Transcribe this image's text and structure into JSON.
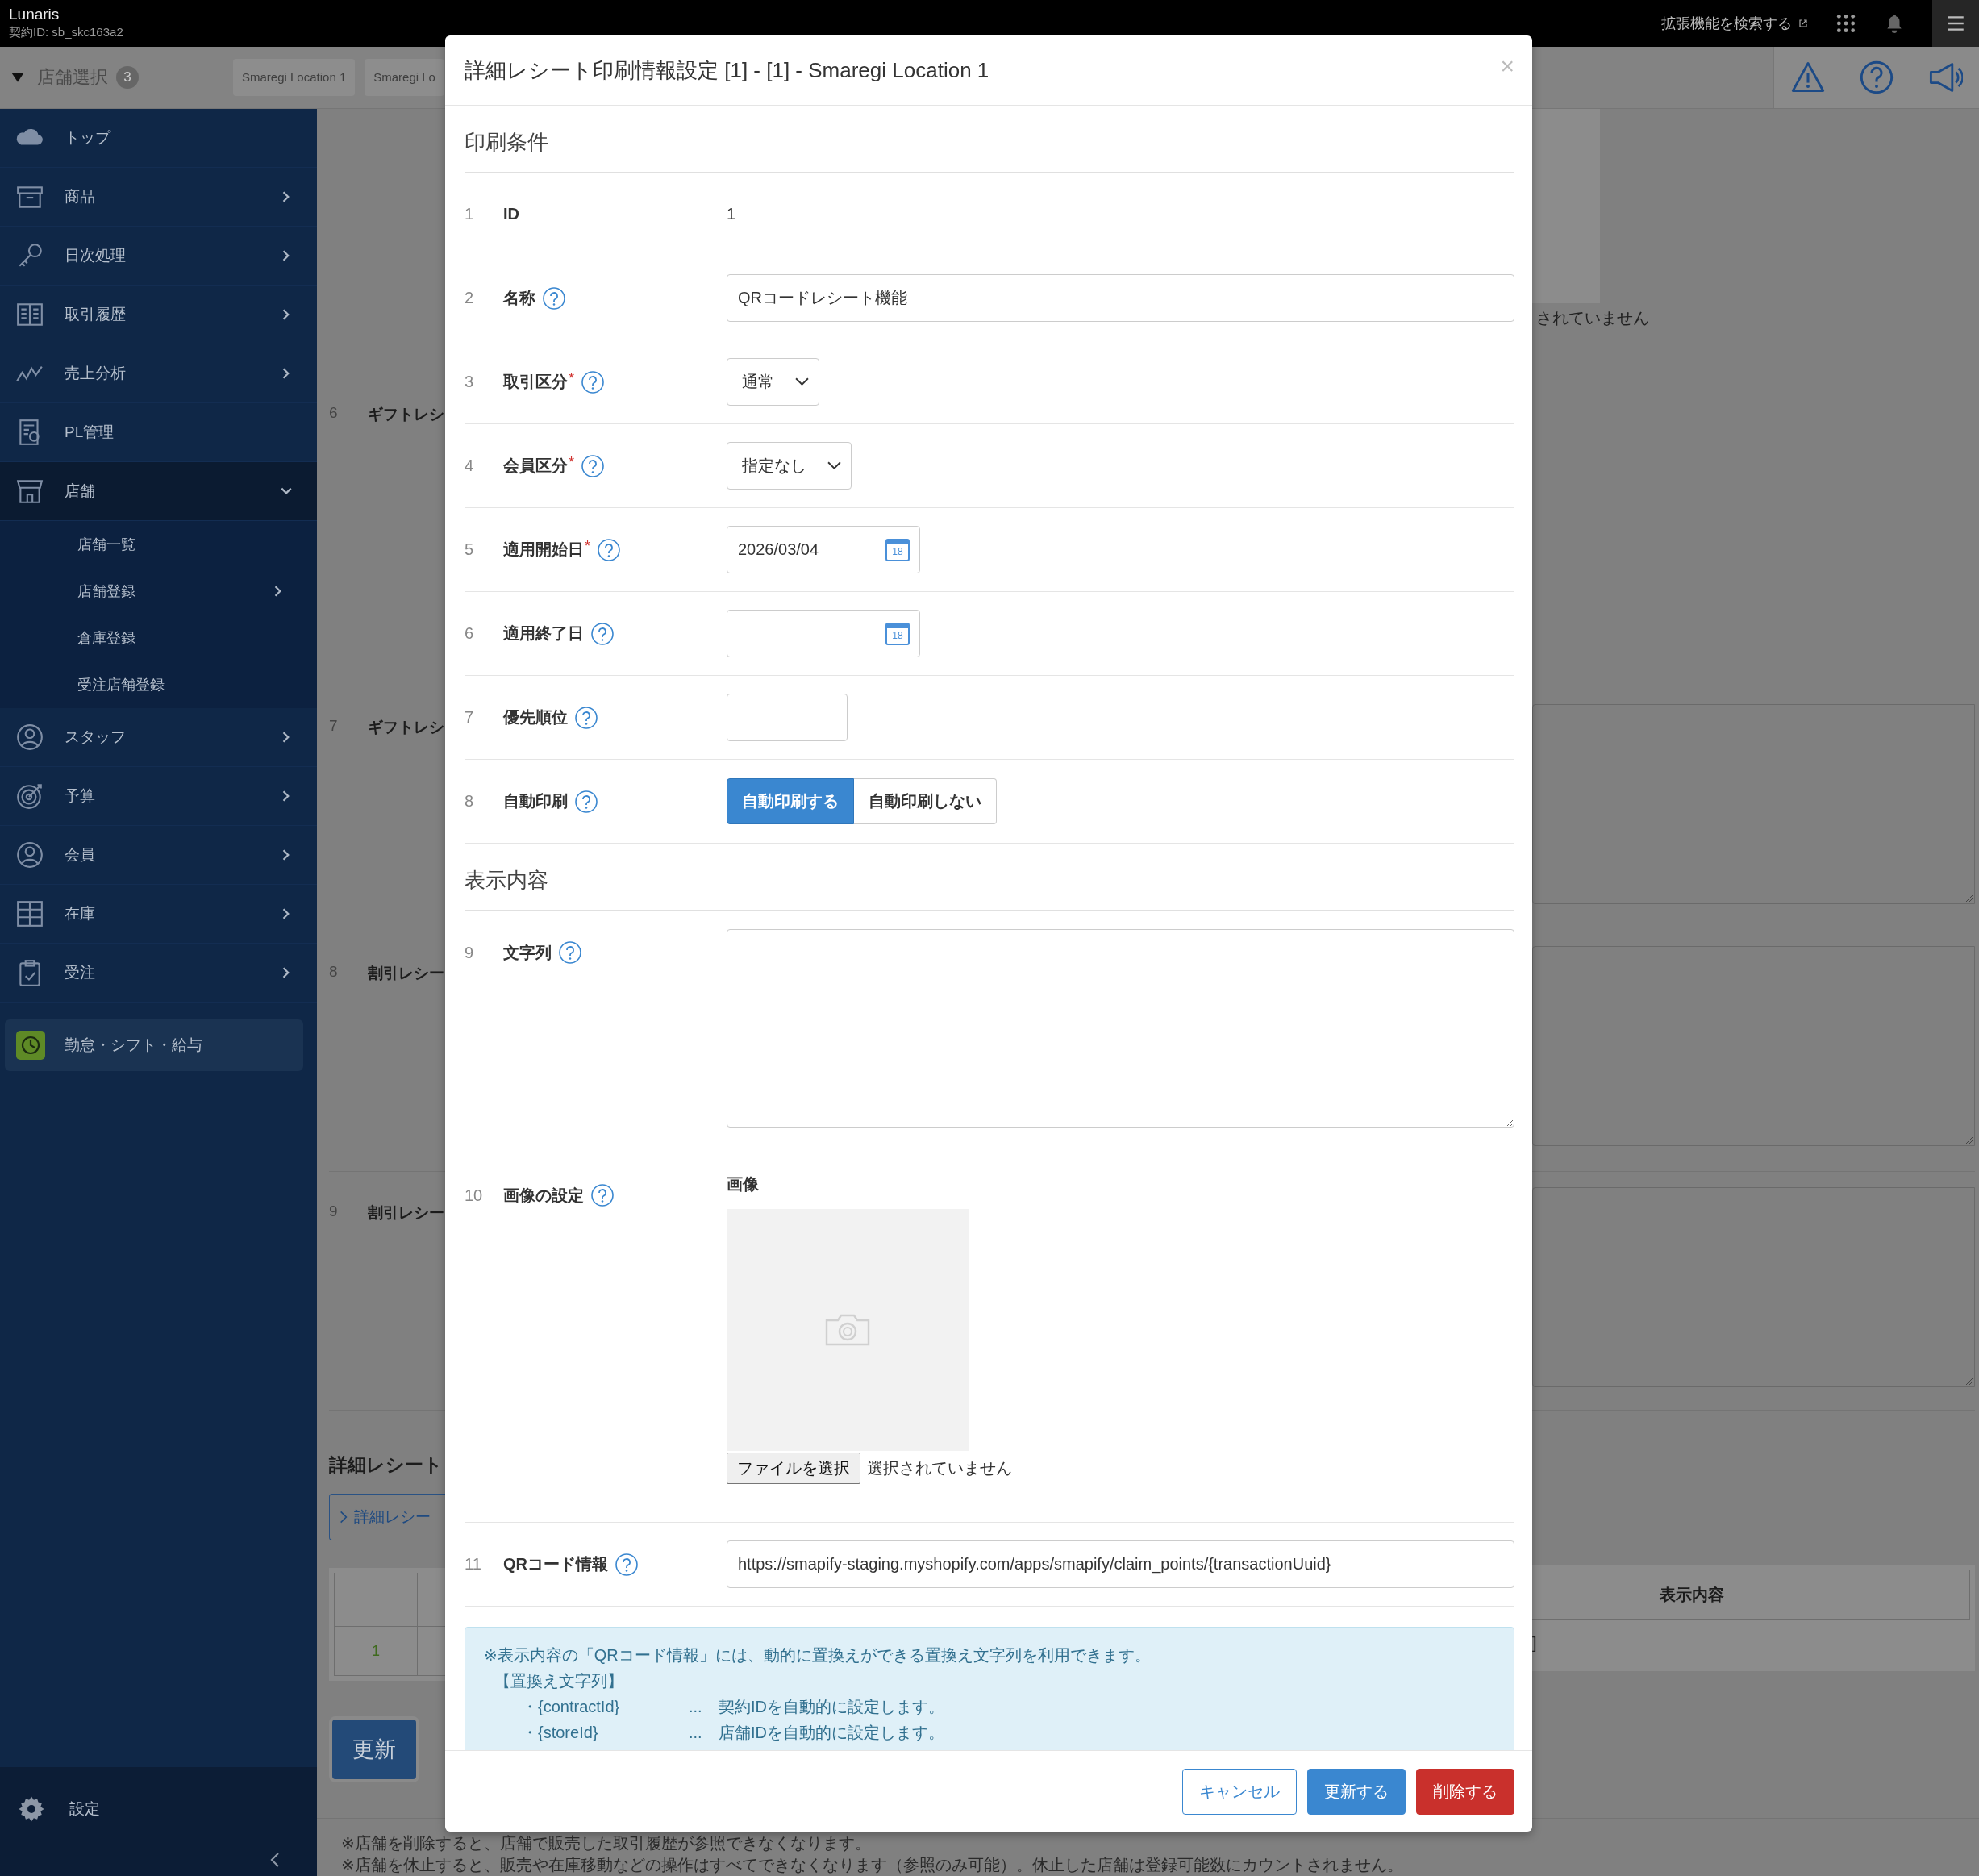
{
  "top_bar": {
    "brand": "Lunaris",
    "contract": "契約ID: sb_skc163a2",
    "extensions_link": "拡張機能を検索する"
  },
  "store_bar": {
    "label": "店舗選択",
    "count": "3",
    "locations": [
      "Smaregi Location 1",
      "Smaregi Lo"
    ]
  },
  "sidebar": {
    "items": [
      {
        "label": "トップ",
        "kind": "link"
      },
      {
        "label": "商品",
        "kind": "menu",
        "expanded": false
      },
      {
        "label": "日次処理",
        "kind": "menu",
        "expanded": false
      },
      {
        "label": "取引履歴",
        "kind": "menu",
        "expanded": false
      },
      {
        "label": "売上分析",
        "kind": "menu",
        "expanded": false
      },
      {
        "label": "PL管理",
        "kind": "link"
      },
      {
        "label": "店舗",
        "kind": "menu",
        "expanded": true,
        "children": [
          {
            "label": "店舗一覧",
            "kind": "link"
          },
          {
            "label": "店舗登録",
            "kind": "menu",
            "expanded": false
          },
          {
            "label": "倉庫登録",
            "kind": "link"
          },
          {
            "label": "受注店舗登録",
            "kind": "link"
          }
        ]
      },
      {
        "label": "スタッフ",
        "kind": "menu",
        "expanded": false
      },
      {
        "label": "予算",
        "kind": "menu",
        "expanded": false
      },
      {
        "label": "会員",
        "kind": "menu",
        "expanded": false
      },
      {
        "label": "在庫",
        "kind": "menu",
        "expanded": false
      },
      {
        "label": "受注",
        "kind": "menu",
        "expanded": false
      }
    ],
    "featured": "勤怠・シフト・給与",
    "settings": "設定"
  },
  "background": {
    "rows": [
      {
        "number": "6",
        "label": "ギフトレシ"
      },
      {
        "number": "7",
        "label": "ギフトレシ"
      },
      {
        "number": "8",
        "label": "割引レシー"
      },
      {
        "number": "9",
        "label": "割引レシー"
      }
    ],
    "file_status": "されていません",
    "section_title": "詳細レシート",
    "link_button": "詳細レシー",
    "table": {
      "column_header": "表示内容",
      "row_number": "1",
      "row_cell": "]"
    },
    "update_button": "更新",
    "notes": [
      "※店舗を削除すると、店舗で販売した取引履歴が参照できなくなります。",
      "※店舗を休止すると、販売や在庫移動などの操作はすべてできなくなります（参照のみ可能）。休止した店舗は登録可能数にカウントされません。"
    ]
  },
  "modal": {
    "title": "詳細レシート印刷情報設定 [1] - [1] - Smaregi Location 1",
    "close": "×",
    "sections": [
      {
        "title": "印刷条件",
        "rows": [
          {
            "number": "1",
            "label": "ID",
            "help": false,
            "kind": "static",
            "value": "1"
          },
          {
            "number": "2",
            "label": "名称",
            "help": true,
            "kind": "input",
            "value": "QRコードレシート機能"
          },
          {
            "number": "3",
            "label": "取引区分",
            "required_mark": "*",
            "help": true,
            "kind": "select",
            "value": "通常"
          },
          {
            "number": "4",
            "label": "会員区分",
            "required_mark": "*",
            "help": true,
            "kind": "select",
            "value": "指定なし"
          },
          {
            "number": "5",
            "label": "適用開始日",
            "required_mark": "*",
            "help": true,
            "kind": "date",
            "value": "2026/03/04",
            "calendar_day": "18"
          },
          {
            "number": "6",
            "label": "適用終了日",
            "help": true,
            "kind": "date",
            "calendar_day": "18"
          },
          {
            "number": "7",
            "label": "優先順位",
            "help": true,
            "kind": "number"
          },
          {
            "number": "8",
            "label": "自動印刷",
            "help": true,
            "kind": "toggle",
            "options": [
              {
                "label": "自動印刷する",
                "selected": true
              },
              {
                "label": "自動印刷しない",
                "selected": false
              }
            ]
          }
        ]
      },
      {
        "title": "表示内容",
        "rows": [
          {
            "number": "9",
            "label": "文字列",
            "help": true,
            "kind": "textarea"
          },
          {
            "number": "10",
            "label": "画像の設定",
            "help": true,
            "kind": "image",
            "caption": "画像",
            "file_button": "ファイルを選択",
            "file_status": "選択されていません"
          },
          {
            "number": "11",
            "label": "QRコード情報",
            "help": true,
            "kind": "input",
            "value": "https://smapify-staging.myshopify.com/apps/smapify/claim_points/{transactionUuid}"
          }
        ]
      }
    ],
    "info": {
      "lines": [
        "※表示内容の「QRコード情報」には、動的に置換えができる置換え文字列を利用できます。",
        "【置換え文字列】"
      ],
      "placeholders": [
        {
          "key": "・{contractId}",
          "dots": "...",
          "description": "契約IDを自動的に設定します。"
        },
        {
          "key": "・{storeId}",
          "dots": "...",
          "description": "店舗IDを自動的に設定します。"
        }
      ]
    },
    "buttons": [
      {
        "label": "キャンセル",
        "kind": "cancel"
      },
      {
        "label": "更新する",
        "kind": "primary"
      },
      {
        "label": "削除する",
        "kind": "danger"
      }
    ]
  }
}
